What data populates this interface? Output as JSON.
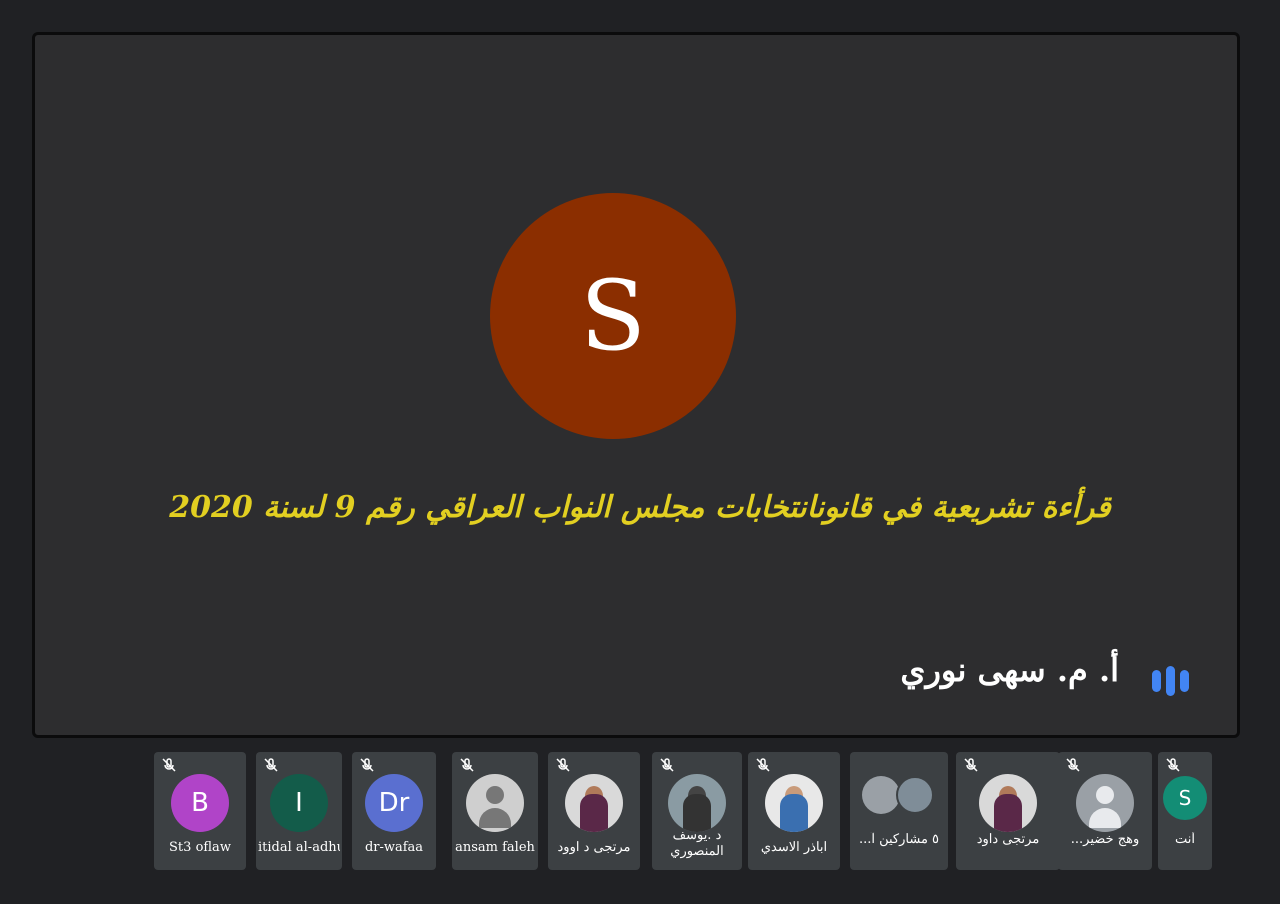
{
  "main": {
    "avatar_letter": "S",
    "avatar_color": "#8b2e00",
    "title": "قرأءة تشريعية في قانونانتخابات مجلس النواب العراقي رقم 9 لسنة 2020",
    "presenter_name": "أ. م. سهى نوري",
    "speaking_icon": "speaking-indicator-icon"
  },
  "participants": [
    {
      "name": "St3 oflaw",
      "avatar": "B",
      "color": "#b044c8",
      "muted": true
    },
    {
      "name": "itidal al-adhub",
      "avatar": "I",
      "color": "#135c4a",
      "muted": true
    },
    {
      "name": "dr-wafaa",
      "avatar": "Dr",
      "color": "#5a6fd0",
      "muted": true
    },
    {
      "name": "ansam faleh",
      "avatar": "photo",
      "muted": true
    },
    {
      "name": "مرتجى د اوود",
      "avatar": "photo",
      "muted": true
    },
    {
      "name": "د .يوسف المنصوري",
      "avatar": "photo",
      "muted": true
    },
    {
      "name": "اباذر الاسدي",
      "avatar": "photo",
      "muted": true
    },
    {
      "name": "٥ مشاركين آ...",
      "avatar": "group"
    },
    {
      "name": "مرتجى داود",
      "avatar": "photo",
      "muted": true
    },
    {
      "name": "وهج خضير...",
      "avatar": "generic",
      "muted": true
    },
    {
      "name": "أنت",
      "avatar": "S",
      "color": "#138d75",
      "muted": true
    }
  ]
}
